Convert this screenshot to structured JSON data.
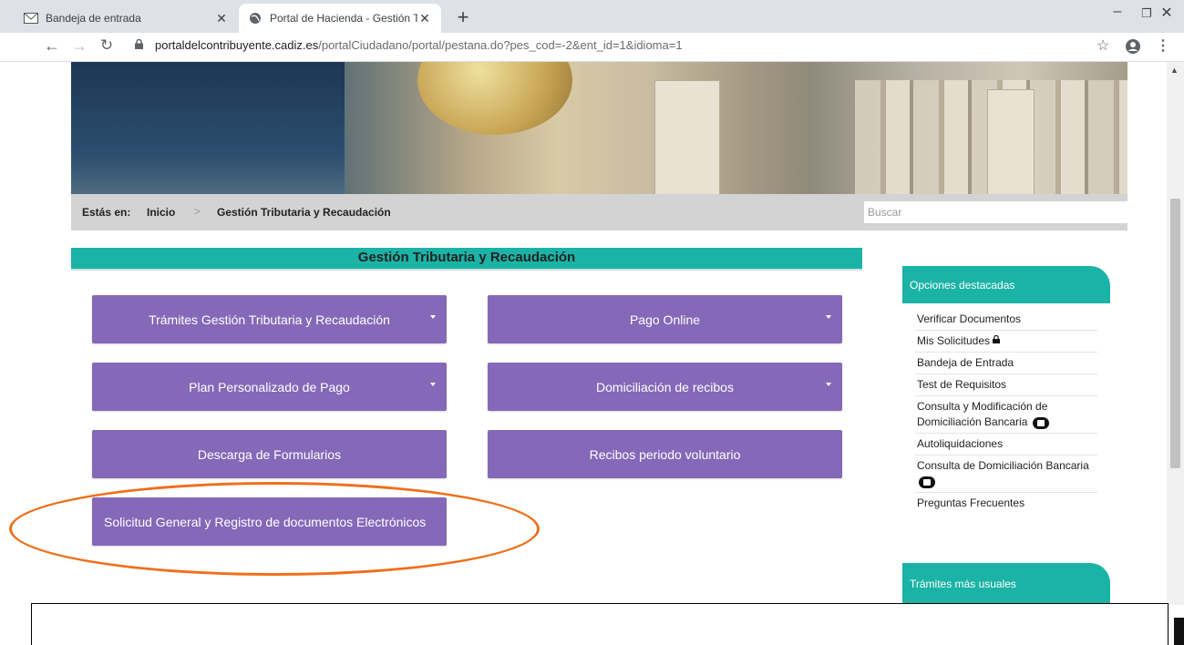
{
  "browser": {
    "tabs": [
      {
        "title": "Bandeja de entrada",
        "active": false
      },
      {
        "title": "Portal de Hacienda - Gestión Trib",
        "active": true
      }
    ],
    "url_host": "portaldelcontribuyente.cadiz.es",
    "url_path": "/portalCiudadano/portal/pestana.do?pes_cod=-2&ent_id=1&idioma=1"
  },
  "breadcrumb": {
    "prefix": "Estás en:",
    "home": "Inicio",
    "current": "Gestión Tributaria y Recaudación"
  },
  "search": {
    "placeholder": "Buscar"
  },
  "main": {
    "title": "Gestión Tributaria y Recaudación",
    "buttons": [
      {
        "label": "Trámites Gestión Tributaria y Recaudación",
        "has_dropdown": true
      },
      {
        "label": "Pago Online",
        "has_dropdown": true
      },
      {
        "label": "Plan Personalizado de Pago",
        "has_dropdown": true
      },
      {
        "label": "Domiciliación de recibos",
        "has_dropdown": true
      },
      {
        "label": "Descarga de Formularios",
        "has_dropdown": false
      },
      {
        "label": "Recibos periodo voluntario",
        "has_dropdown": false
      },
      {
        "label": "Solicitud General y Registro de documentos Electrónicos",
        "has_dropdown": false
      }
    ]
  },
  "sidebar": {
    "featured_title": "Opciones destacadas",
    "items": [
      {
        "label": "Verificar Documentos"
      },
      {
        "label": "Mis Solicitudes"
      },
      {
        "label": "Bandeja de Entrada"
      },
      {
        "label": "Test de Requisitos"
      },
      {
        "label": "Consulta y Modificación de Domiciliación Bancaria"
      },
      {
        "label": "Autoliquidaciones"
      },
      {
        "label": "Consulta de Domiciliación Bancaria"
      },
      {
        "label": "Preguntas Frecuentes"
      }
    ],
    "usual_title": "Trámites más usuales"
  },
  "colors": {
    "accent_teal": "#1bb3a6",
    "button_purple": "#8568b8",
    "highlight_orange": "#ee6f1c"
  }
}
